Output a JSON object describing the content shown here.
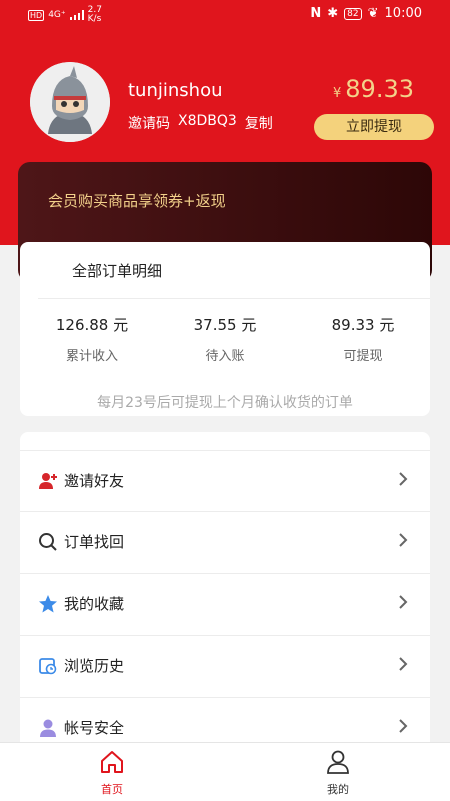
{
  "status_bar": {
    "signal": "4G⁺",
    "hd": "HD",
    "speed": "2.7",
    "speed_unit": "K/s",
    "battery": "82",
    "time": "10:00",
    "nfc": "N"
  },
  "profile": {
    "username": "tunjinshou",
    "invite_label": "邀请码",
    "invite_code": "X8DBQ3",
    "copy_label": "复制"
  },
  "balance": {
    "currency": "¥",
    "amount": "89.33",
    "withdraw_label": "立即提现"
  },
  "member_card": {
    "text": "会员购买商品享领券+返现"
  },
  "orders": {
    "title": "全部订单明细",
    "stats": [
      {
        "value": "126.88 元",
        "label": "累计收入"
      },
      {
        "value": "37.55 元",
        "label": "待入账"
      },
      {
        "value": "89.33 元",
        "label": "可提现"
      }
    ],
    "note": "每月23号后可提现上个月确认收货的订单"
  },
  "menu": [
    {
      "label": "邀请好友",
      "icon": "invite-user-icon"
    },
    {
      "label": "订单找回",
      "icon": "search-icon"
    },
    {
      "label": "我的收藏",
      "icon": "star-icon"
    },
    {
      "label": "浏览历史",
      "icon": "history-icon"
    },
    {
      "label": "帐号安全",
      "icon": "user-icon"
    }
  ],
  "tabs": [
    {
      "label": "首页",
      "icon": "home-icon",
      "active": true
    },
    {
      "label": "我的",
      "icon": "profile-icon",
      "active": false
    }
  ],
  "colors": {
    "primary": "#e0151d",
    "gold": "#f4d27c",
    "gold_text": "#f2d08a",
    "card_dark": "#3a0c0d"
  }
}
